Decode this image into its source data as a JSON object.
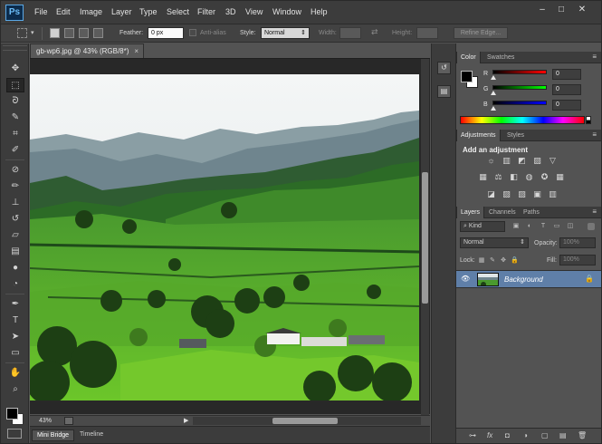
{
  "app": {
    "logo": "Ps",
    "menus": [
      "File",
      "Edit",
      "Image",
      "Layer",
      "Type",
      "Select",
      "Filter",
      "3D",
      "View",
      "Window",
      "Help"
    ],
    "window_controls": [
      "–",
      "□",
      "✕"
    ]
  },
  "options_bar": {
    "feather_label": "Feather:",
    "feather_value": "0 px",
    "antialias_label": "Anti-alias",
    "style_label": "Style:",
    "style_value": "Normal",
    "width_label": "Width:",
    "height_label": "Height:",
    "refine_edge_label": "Refine Edge..."
  },
  "tools": [
    {
      "icon": "move-icon",
      "glyph": "✥"
    },
    {
      "icon": "rectangular-marquee-icon",
      "glyph": "⬚",
      "active": true
    },
    {
      "icon": "lasso-icon",
      "glyph": "ᘐ"
    },
    {
      "icon": "quick-selection-icon",
      "glyph": "✎"
    },
    {
      "icon": "crop-icon",
      "glyph": "⌗"
    },
    {
      "icon": "eyedropper-icon",
      "glyph": "✐"
    },
    {
      "icon": "healing-brush-icon",
      "glyph": "⊘"
    },
    {
      "icon": "brush-icon",
      "glyph": "✏"
    },
    {
      "icon": "clone-stamp-icon",
      "glyph": "⊥"
    },
    {
      "icon": "history-brush-icon",
      "glyph": "↺"
    },
    {
      "icon": "eraser-icon",
      "glyph": "▱"
    },
    {
      "icon": "gradient-icon",
      "glyph": "▤"
    },
    {
      "icon": "blur-icon",
      "glyph": "●"
    },
    {
      "icon": "dodge-icon",
      "glyph": "◔"
    },
    {
      "icon": "pen-icon",
      "glyph": "✒"
    },
    {
      "icon": "type-icon",
      "glyph": "T"
    },
    {
      "icon": "path-selection-icon",
      "glyph": "➤"
    },
    {
      "icon": "rectangle-shape-icon",
      "glyph": "▭"
    },
    {
      "icon": "hand-icon",
      "glyph": "✋"
    },
    {
      "icon": "zoom-icon",
      "glyph": "⌕"
    }
  ],
  "document": {
    "tab_title": "gb-wp6.jpg @ 43% (RGB/8*)",
    "close_glyph": "×",
    "zoom": "43%"
  },
  "bottom_tabs": [
    "Mini Bridge",
    "Timeline"
  ],
  "color_panel": {
    "tabs": [
      "Color",
      "Swatches"
    ],
    "channels": [
      {
        "label": "R",
        "value": "0",
        "color": "#ff0000"
      },
      {
        "label": "G",
        "value": "0",
        "color": "#00ff00"
      },
      {
        "label": "B",
        "value": "0",
        "color": "#0000ff"
      }
    ]
  },
  "adjustments_panel": {
    "tabs": [
      "Adjustments",
      "Styles"
    ],
    "title": "Add an adjustment",
    "row1": [
      "☼",
      "▥",
      "◩",
      "▨",
      "▽"
    ],
    "row2": [
      "▦",
      "⚖",
      "◧",
      "◍",
      "✪",
      "▦"
    ],
    "row3": [
      "◪",
      "▨",
      "▨",
      "▣",
      "▥"
    ]
  },
  "layers_panel": {
    "tabs": [
      "Layers",
      "Channels",
      "Paths"
    ],
    "filter_label": "Kind",
    "blend_mode": "Normal",
    "opacity_label": "Opacity:",
    "opacity_value": "100%",
    "lock_label": "Lock:",
    "fill_label": "Fill:",
    "fill_value": "100%",
    "layer_name": "Background",
    "footer_icons": [
      "⊶",
      "fx",
      "◘",
      "◑",
      "▢",
      "▤",
      "🗑"
    ]
  }
}
